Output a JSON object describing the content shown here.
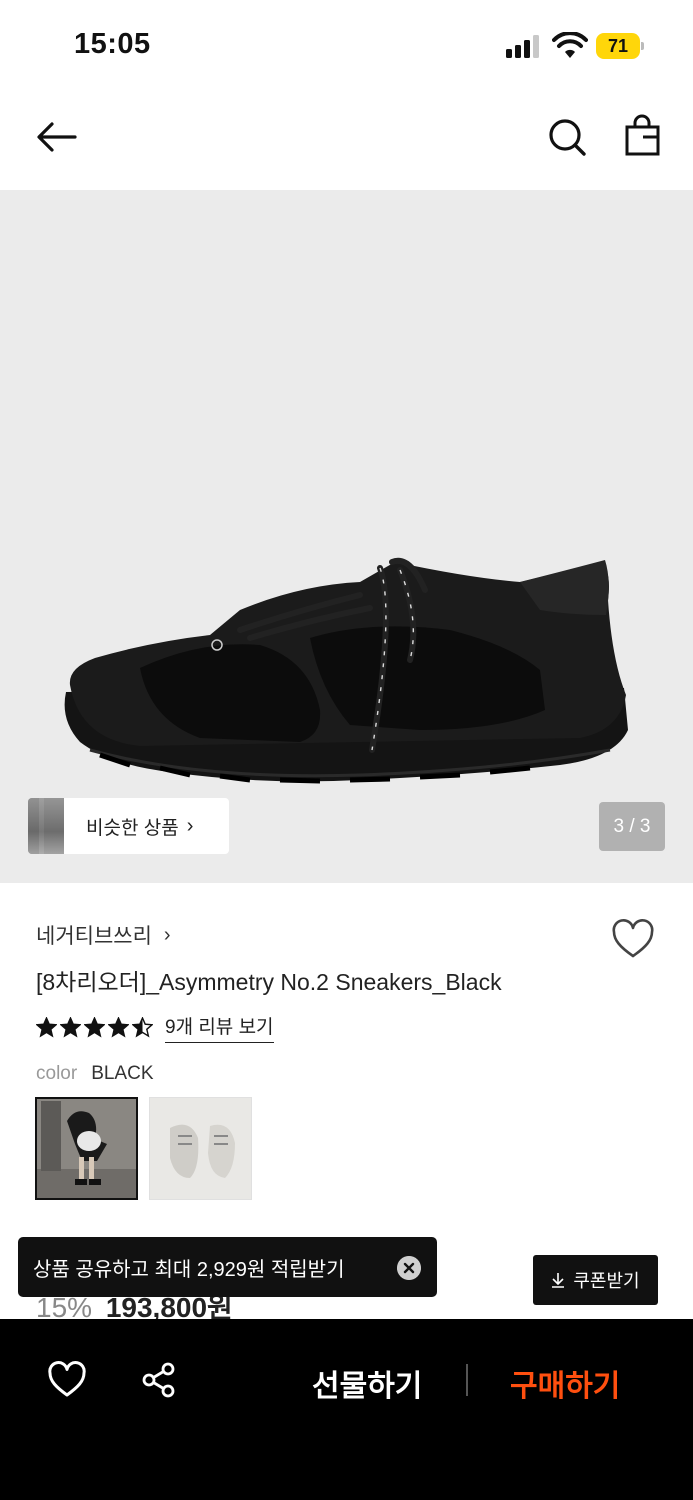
{
  "status_bar": {
    "time": "15:05",
    "battery": "71"
  },
  "header": {
    "back_icon": "arrow-left-icon",
    "search_icon": "search-icon",
    "bag_icon": "shopping-bag-icon"
  },
  "gallery": {
    "similar_label": "비슷한 상품",
    "page_indicator": "3 / 3"
  },
  "product": {
    "brand": "네거티브쓰리",
    "name": "[8차리오더]_Asymmetry No.2 Sneakers_Black",
    "rating": 4.5,
    "review_link": "9개 리뷰 보기",
    "color_label": "color",
    "color_value": "BLACK"
  },
  "toast": {
    "text": "상품 공유하고 최대 2,929원 적립받기"
  },
  "price_peek": {
    "discount": "15%",
    "price": "193,800원"
  },
  "coupon": {
    "label": "쿠폰받기"
  },
  "bottom_bar": {
    "gift_label": "선물하기",
    "buy_label": "구매하기"
  },
  "colors": {
    "accent": "#ff4f0f",
    "battery": "#ffd60a",
    "image_bg": "#ebebeb"
  }
}
